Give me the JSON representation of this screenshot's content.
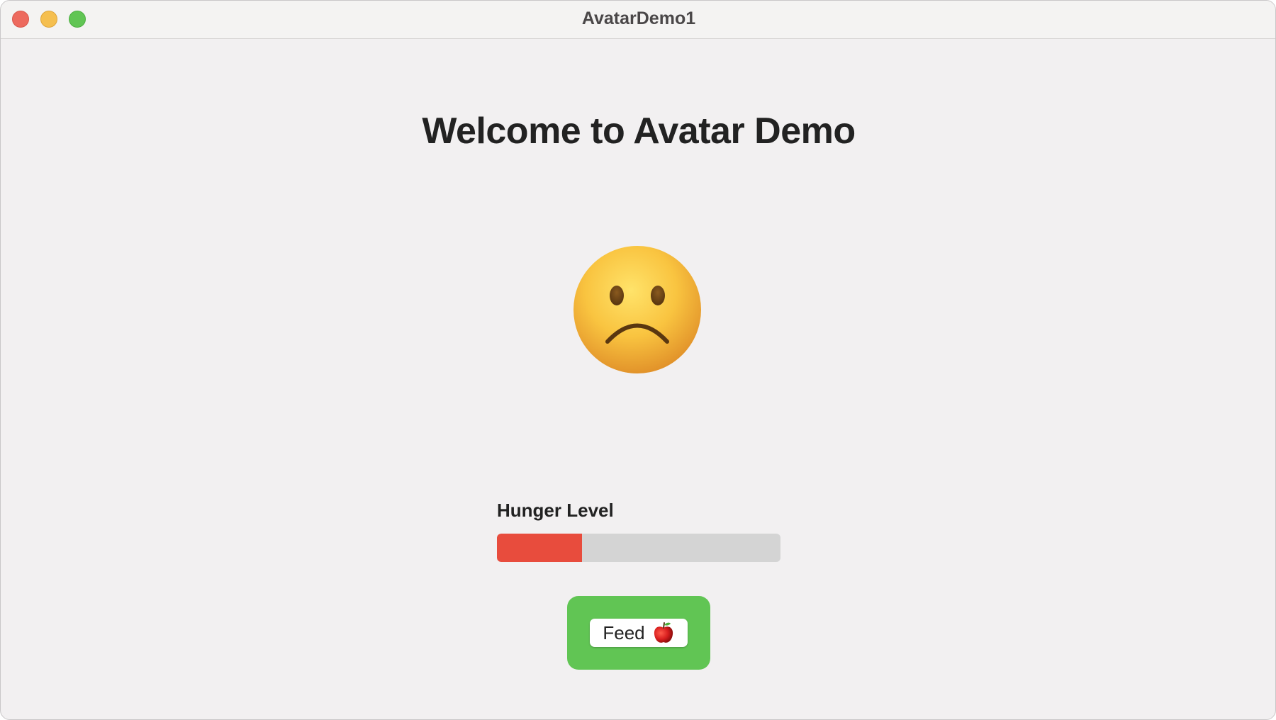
{
  "window": {
    "title": "AvatarDemo1"
  },
  "main": {
    "heading": "Welcome to Avatar Demo",
    "avatar": {
      "icon": "sad-face-icon",
      "mood": "sad"
    },
    "hunger": {
      "label": "Hunger Level",
      "level": 0.3,
      "fill_color": "#e84c3d",
      "track_color": "#d4d4d4"
    },
    "feed_button": {
      "label": "Feed",
      "icon": "apple-icon",
      "container_color": "#61c554"
    }
  }
}
